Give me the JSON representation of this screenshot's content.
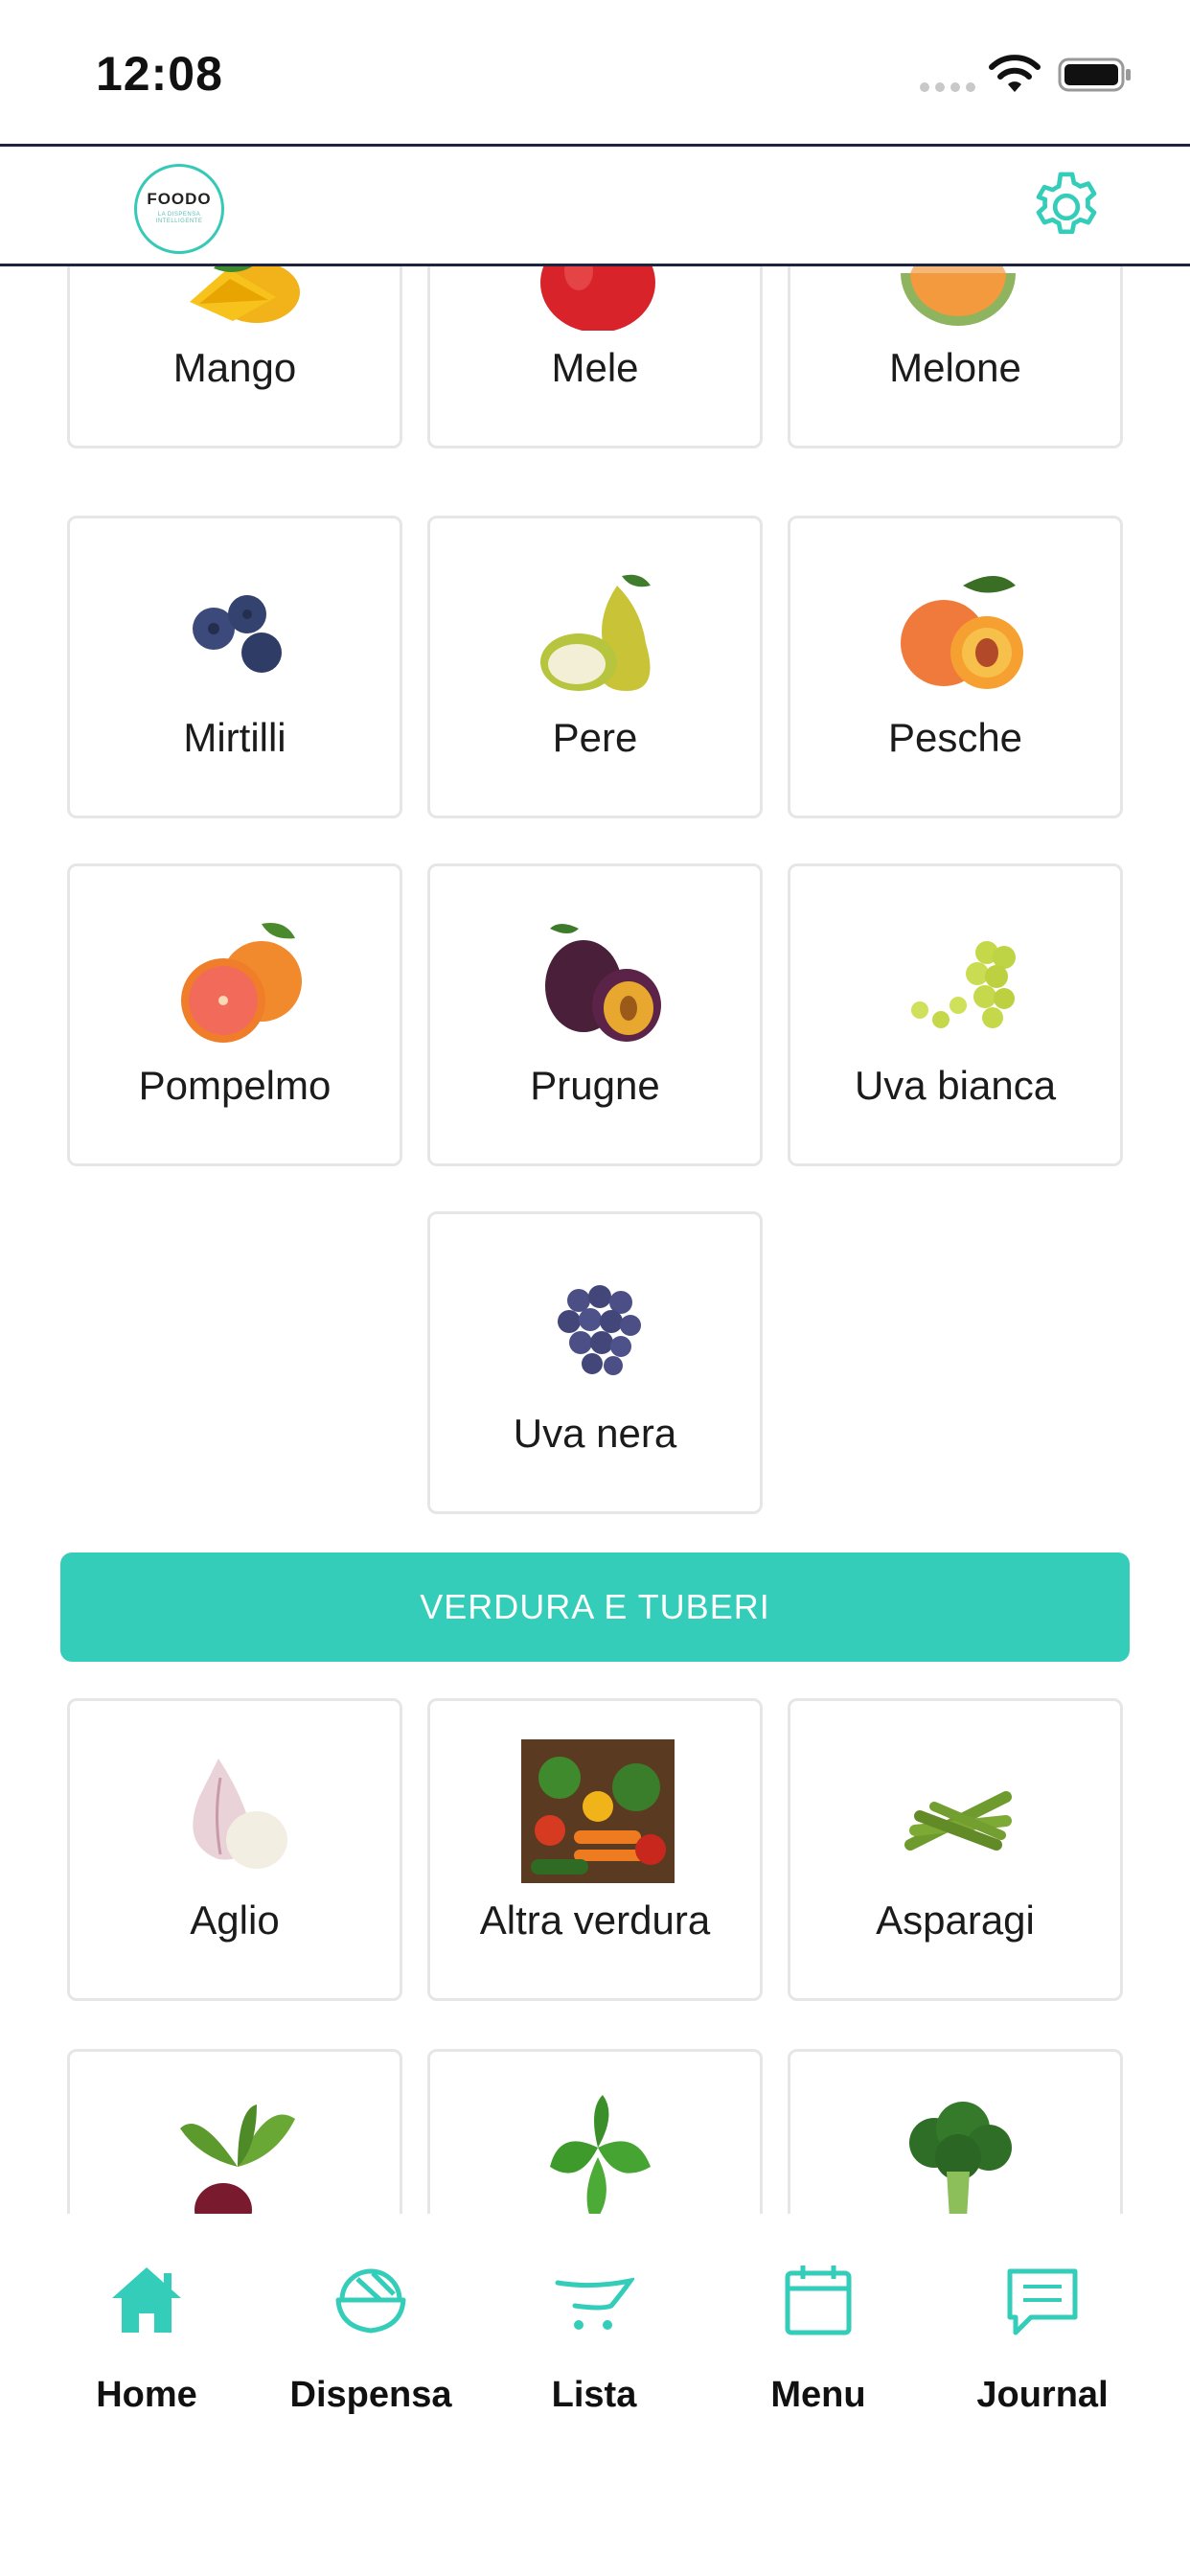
{
  "status_bar": {
    "time": "12:08"
  },
  "header": {
    "logo_text": "FOODO",
    "logo_sub": "LA DISPENSA INTELLIGENTE",
    "settings_icon": "gear-icon"
  },
  "colors": {
    "accent": "#34cdb9",
    "header_border": "#1e2340",
    "card_border": "#e6e6e6"
  },
  "fruit_items": [
    "Mango",
    "Mele",
    "Melone",
    "Mirtilli",
    "Pere",
    "Pesche",
    "Pompelmo",
    "Prugne",
    "Uva bianca",
    "Uva nera"
  ],
  "category_vegetables": "VERDURA E TUBERI",
  "vegetable_items": [
    "Aglio",
    "Altra verdura",
    "Asparagi"
  ],
  "nav": [
    {
      "label": "Home",
      "icon": "home-icon"
    },
    {
      "label": "Dispensa",
      "icon": "bowl-icon"
    },
    {
      "label": "Lista",
      "icon": "cart-icon"
    },
    {
      "label": "Menu",
      "icon": "calendar-icon"
    },
    {
      "label": "Journal",
      "icon": "chat-icon"
    }
  ]
}
